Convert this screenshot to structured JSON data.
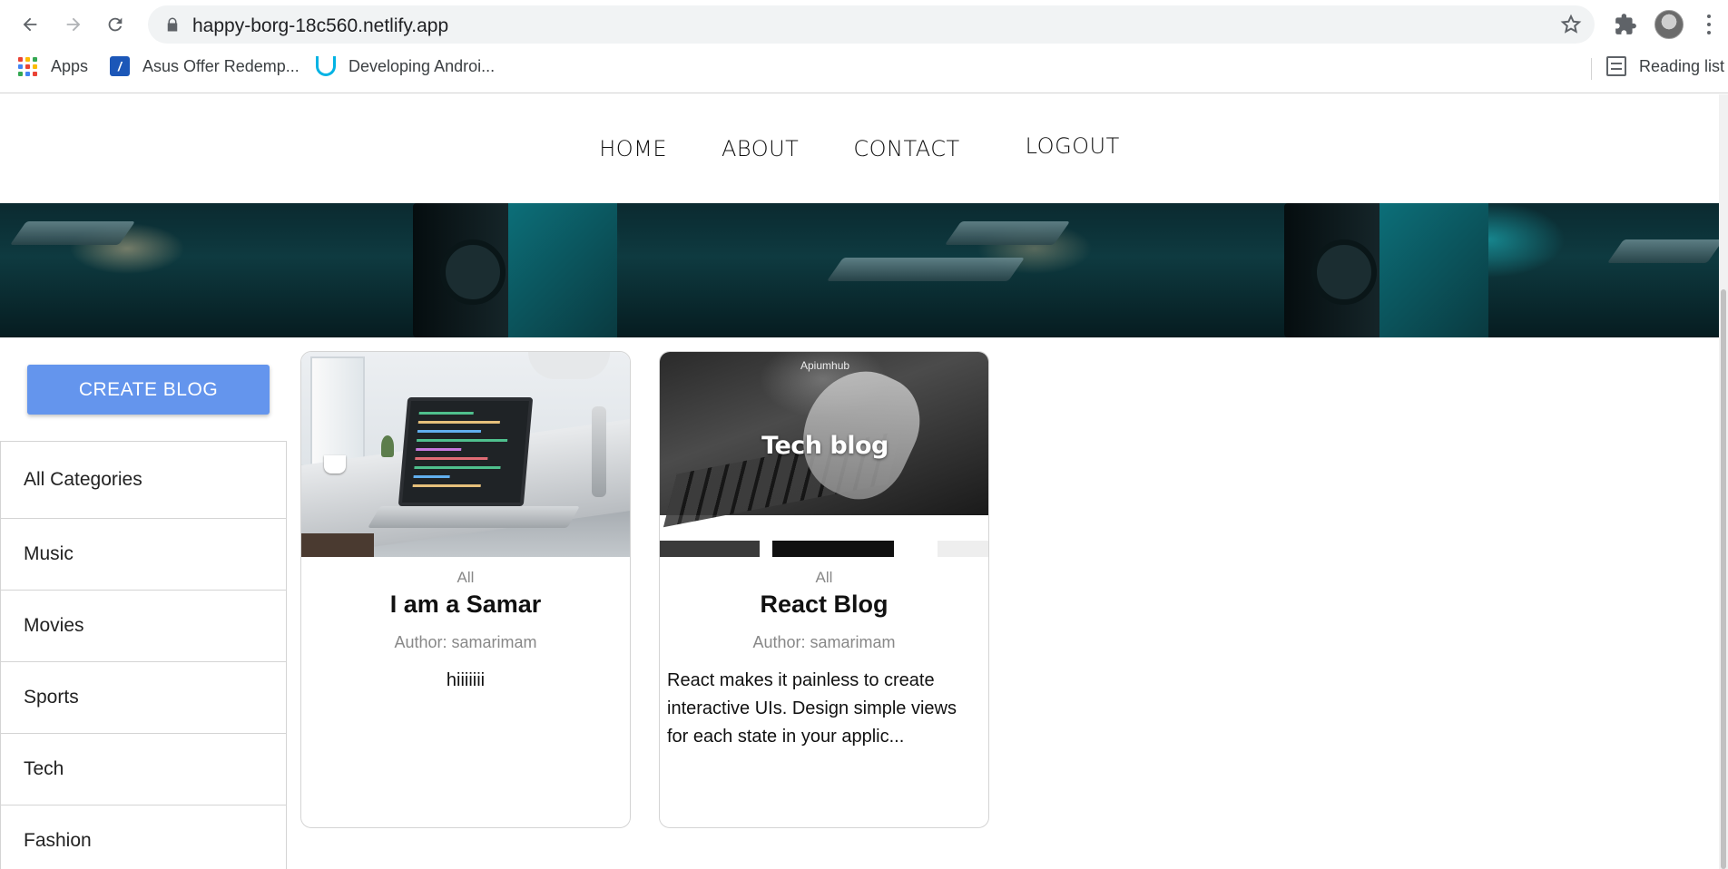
{
  "browser": {
    "url": "happy-borg-18c560.netlify.app",
    "bookmarks": [
      {
        "label": "Apps",
        "icon": "apps-grid-icon"
      },
      {
        "label": "Asus Offer Redemp...",
        "icon": "asus-icon"
      },
      {
        "label": "Developing Androi...",
        "icon": "udacity-icon"
      }
    ],
    "reading_list": "Reading list"
  },
  "nav": {
    "items": [
      "HOME",
      "ABOUT",
      "CONTACT",
      "LOGOUT"
    ]
  },
  "sidebar": {
    "create_label": "CREATE BLOG",
    "categories": [
      "All Categories",
      "Music",
      "Movies",
      "Sports",
      "Tech",
      "Fashion"
    ]
  },
  "posts": [
    {
      "category": "All",
      "title": "I am a Samar",
      "author": "Author: samarimam",
      "description": "hiiiiiii"
    },
    {
      "category": "All",
      "title": "React Blog",
      "author": "Author: samarimam",
      "description": "React makes it painless to create interactive UIs. Design simple views for each state in your applic...",
      "image_caption": "Tech blog",
      "image_brand": "Apiumhub"
    }
  ],
  "colors": {
    "create_button": "#6495ed",
    "apps_grid": [
      "#ea4335",
      "#fbbc04",
      "#34a853",
      "#4285f4",
      "#ea4335",
      "#fbbc04",
      "#34a853",
      "#4285f4",
      "#ea4335"
    ]
  }
}
